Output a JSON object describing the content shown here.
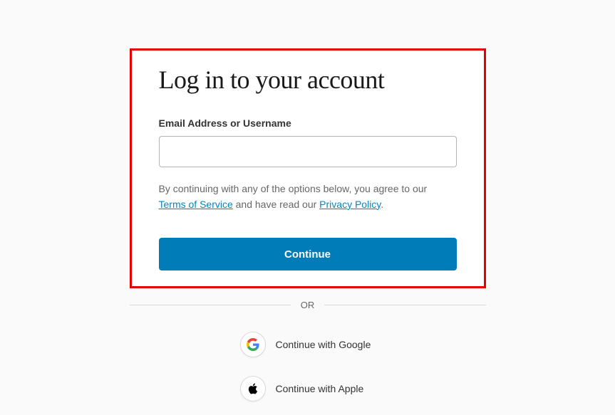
{
  "title": "Log in to your account",
  "field": {
    "label": "Email Address or Username",
    "value": ""
  },
  "terms": {
    "prefix": "By continuing with any of the options below, you agree to our ",
    "tos_label": "Terms of Service",
    "middle": " and have read our ",
    "privacy_label": "Privacy Policy",
    "suffix": "."
  },
  "continue_label": "Continue",
  "divider_label": "OR",
  "social": {
    "google_label": "Continue with Google",
    "apple_label": "Continue with Apple"
  }
}
